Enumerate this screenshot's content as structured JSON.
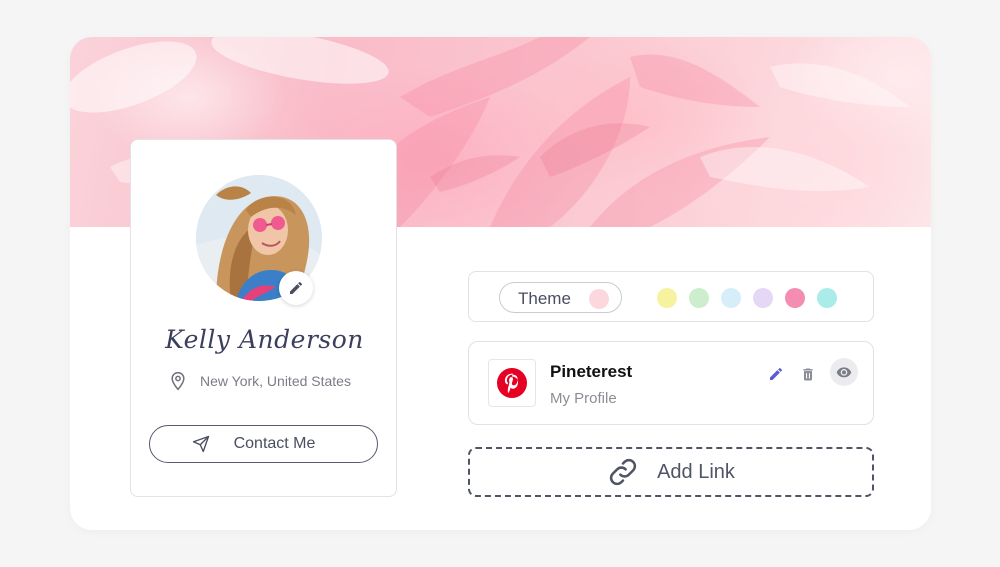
{
  "profile": {
    "name": "Kelly Anderson",
    "location": "New York, United States",
    "contact_label": "Contact Me"
  },
  "theme": {
    "label": "Theme",
    "current_color": "#fbd8de",
    "swatches": [
      "#f6f2a0",
      "#cdeecd",
      "#d6eef9",
      "#e5d8f7",
      "#f58db3",
      "#a9ece9"
    ]
  },
  "link": {
    "title": "Pineterest",
    "subtitle": "My Profile",
    "brand_color": "#e60023"
  },
  "add_link": {
    "label": "Add Link"
  },
  "colors": {
    "accent_edit": "#5b5bd6",
    "text_dark": "#4a4e60"
  }
}
